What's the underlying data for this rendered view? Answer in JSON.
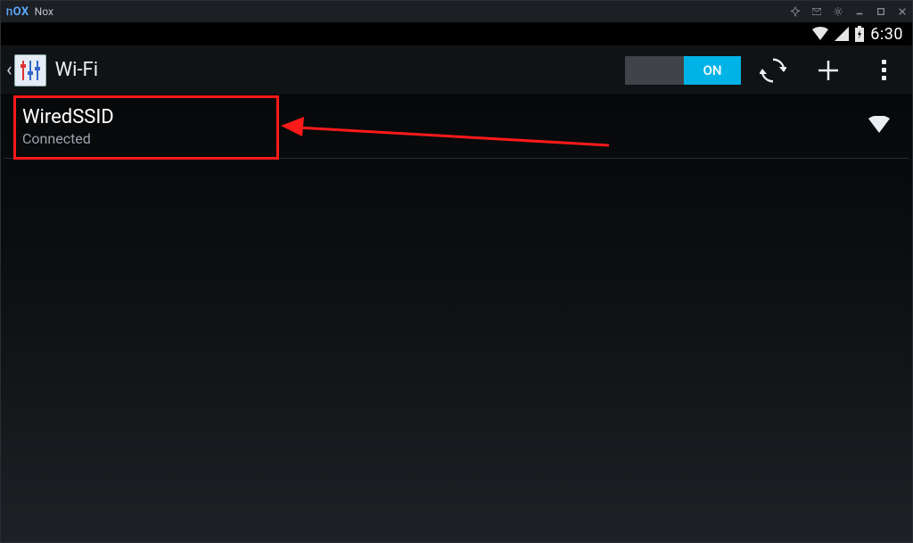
{
  "titlebar": {
    "app_name": "Nox"
  },
  "statusbar": {
    "time": "6:30"
  },
  "actionbar": {
    "title": "Wi-Fi",
    "toggle_on_label": "ON"
  },
  "wifi_list": {
    "items": [
      {
        "ssid": "WiredSSID",
        "status": "Connected"
      }
    ]
  }
}
